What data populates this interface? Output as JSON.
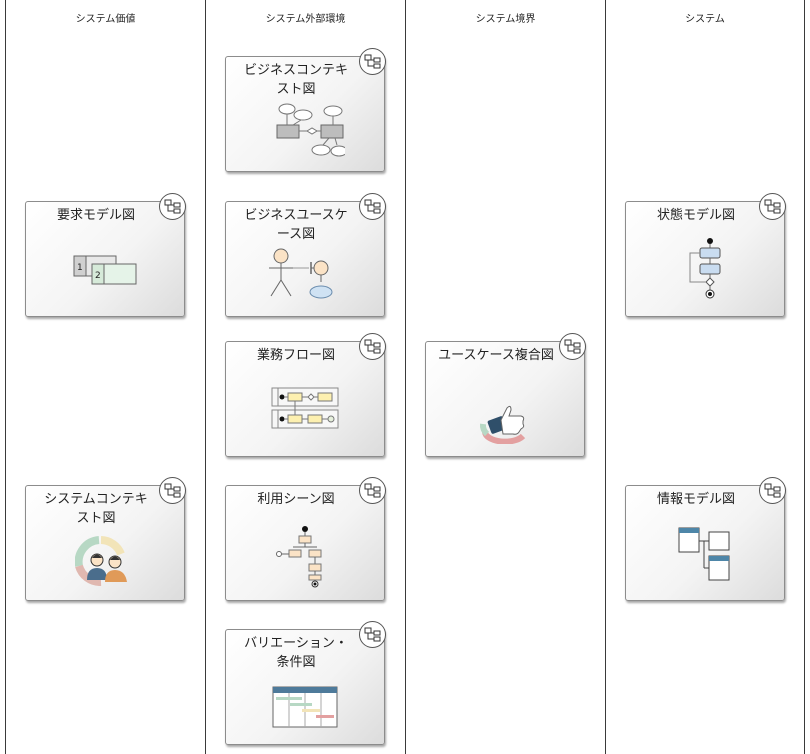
{
  "lanes": [
    {
      "title": "システム価値"
    },
    {
      "title": "システム外部環境"
    },
    {
      "title": "システム境界"
    },
    {
      "title": "システム"
    }
  ],
  "cards": {
    "requirement_model": {
      "label": "要求モデル図"
    },
    "system_context": {
      "label": "システムコンテキスト図"
    },
    "business_context": {
      "label": "ビジネスコンテキスト図"
    },
    "business_usecase": {
      "label": "ビジネスユースケース図"
    },
    "business_flow": {
      "label": "業務フロー図"
    },
    "usage_scene": {
      "label": "利用シーン図"
    },
    "variation_condition": {
      "label": "バリエーション・条件図"
    },
    "usecase_composite": {
      "label": "ユースケース複合図"
    },
    "state_model": {
      "label": "状態モデル図"
    },
    "information_model": {
      "label": "情報モデル図"
    }
  }
}
